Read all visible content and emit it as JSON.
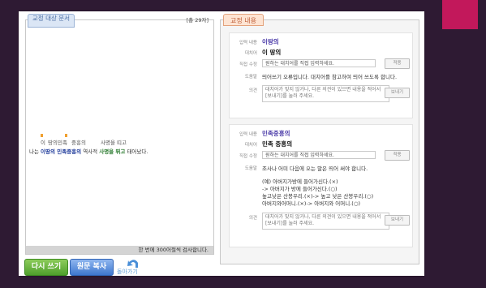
{
  "left_panel": {
    "tab_label": "교정 대상 문서",
    "total_count": "[총 29자]",
    "sentence_upper": [
      "이",
      "땅의민족",
      "중흥의",
      "사명을 띠고"
    ],
    "sentence_lower": {
      "p1": "나는 ",
      "bold1": "이땅의 민족중흥의",
      "p2": " 역사적 ",
      "bold2": "사명을 뛰고",
      "p3": " 태어났다."
    },
    "footer": "한 번에 300어절씩 검사합니다."
  },
  "buttons": {
    "rewrite": "다시 쓰기",
    "copy": "원문 복사",
    "back": "돌아가기"
  },
  "right_panel": {
    "tab_label": "교정 내용",
    "cards": [
      {
        "input_label": "입력 내용",
        "input_value": "이땅의",
        "replace_label": "대치어",
        "replace_value": "이 땅의",
        "direct_label": "직접 수정",
        "direct_placeholder": "원하는 대치어를 직접 입력하세요.",
        "apply_button": "적용",
        "help_label": "도움말",
        "help_text": "띄어쓰기 오류입니다. 대치어를 참고하여 띄어 쓰도록 합니다.",
        "opinion_label": "의견",
        "opinion_placeholder": "대치어가 맞지 않거나, 다른 의견이 있으면 내용을 적어서 [보내기]를 눌러 주세요.",
        "send_button": "보내기"
      },
      {
        "input_label": "입력 내용",
        "input_value": "민족중흥의",
        "replace_label": "대치어",
        "replace_value": "민족 중흥의",
        "direct_label": "직접 수정",
        "direct_placeholder": "원하는 대치어를 직접 입력하세요.",
        "apply_button": "적용",
        "help_label": "도움말",
        "help_text": "조사나 어미 다음에 오는 말은 띄어 써야 합니다.",
        "examples": [
          "(예) 아버지가방에 들어가신다.(×)",
          "-> 아버지가 방에 들어가신다.(○)",
          "높고낮은 산봉우리.(×)-> 높고 낮은 산봉우리.(○)",
          "아버지와어머니.(×)-> 아버지와 어머니.(○)"
        ],
        "opinion_label": "의견",
        "opinion_placeholder": "대치어가 맞지 않거나, 다른 의견이 있으면 내용을 적어서 [보내기]를 눌러 주세요.",
        "send_button": "보내기"
      }
    ]
  },
  "colors": {
    "accent_pink": "#c2185b",
    "background": "#2e1a33",
    "button_green": "#5aa632",
    "button_blue": "#4a80d6",
    "highlight_purple": "#4a3aa8"
  },
  "icons": [
    "back-arrow-icon"
  ]
}
